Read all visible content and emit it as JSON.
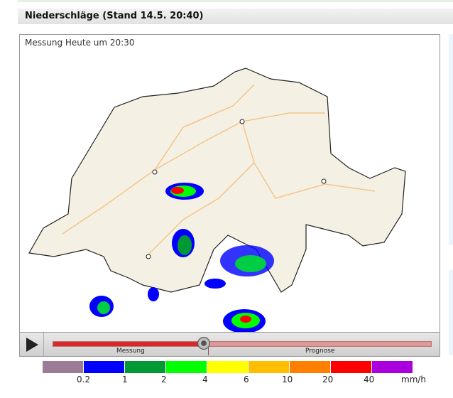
{
  "header": {
    "title": "Niederschläge (Stand 14.5. 20:40)"
  },
  "map": {
    "caption": "Messung Heute um 20:30"
  },
  "timeline": {
    "past_label": "Messung",
    "future_label": "Prognose",
    "position_percent": 40.5
  },
  "legend": {
    "colors": [
      "#9b7b96",
      "#0000ff",
      "#009933",
      "#00ff00",
      "#ffff00",
      "#ffbf00",
      "#ff7f00",
      "#ff0000",
      "#aa00dd"
    ],
    "labels": [
      "0.2",
      "1",
      "2",
      "4",
      "6",
      "10",
      "20",
      "40"
    ],
    "unit": "mm/h"
  }
}
